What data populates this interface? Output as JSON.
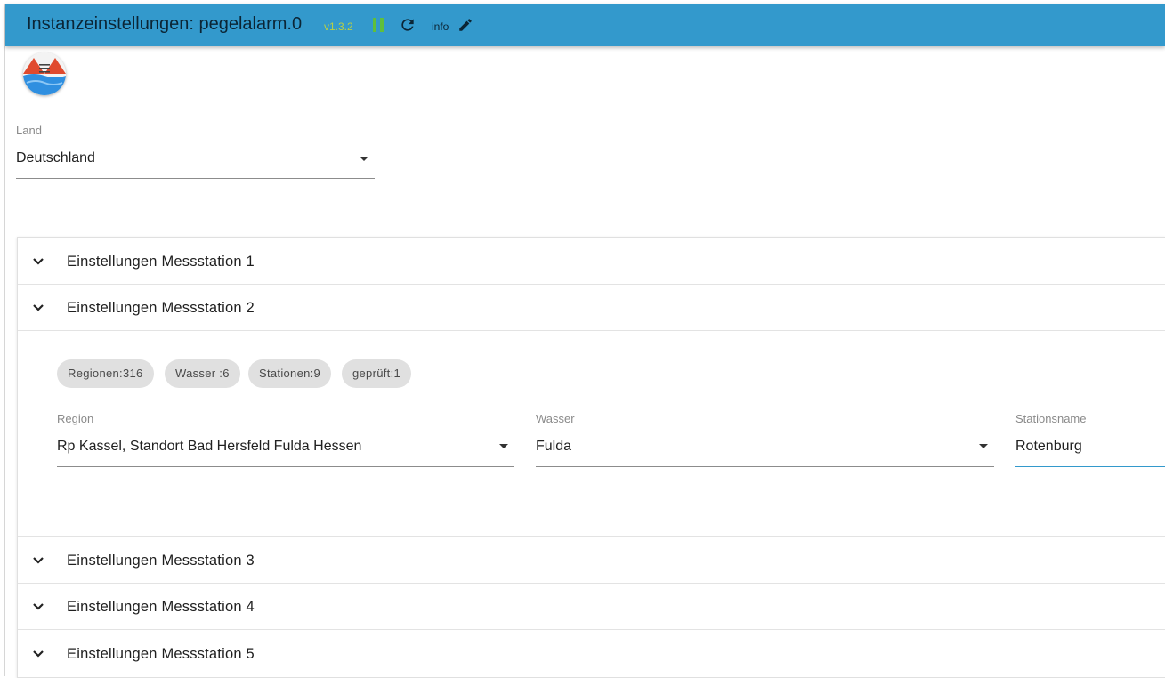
{
  "header": {
    "title": "Instanzeinstellungen: pegelalarm.0",
    "version": "v1.3.2",
    "info_label": "info",
    "icons": [
      "pause-icon",
      "reload-icon",
      "edit-icon"
    ]
  },
  "country": {
    "label": "Land",
    "value": "Deutschland"
  },
  "stations": [
    {
      "label": "Einstellungen Messstation 1"
    },
    {
      "label": "Einstellungen Messstation 2",
      "chips": [
        "Regionen:316",
        "Wasser :6",
        "Stationen:9",
        "geprüft:1"
      ],
      "region": {
        "label": "Region",
        "value": "Rp Kassel, Standort Bad Hersfeld Fulda Hessen"
      },
      "water": {
        "label": "Wasser",
        "value": "Fulda"
      },
      "station": {
        "label": "Stationsname",
        "value": "Rotenburg"
      }
    },
    {
      "label": "Einstellungen Messstation 3"
    },
    {
      "label": "Einstellungen Messstation 4"
    },
    {
      "label": "Einstellungen Messstation 5"
    }
  ],
  "colors": {
    "header_bg": "#3399cc",
    "version": "#b9cf45",
    "pause": "#5fbf3c",
    "chip_bg": "#e0e0e0",
    "focus_underline": "#3399cc"
  }
}
